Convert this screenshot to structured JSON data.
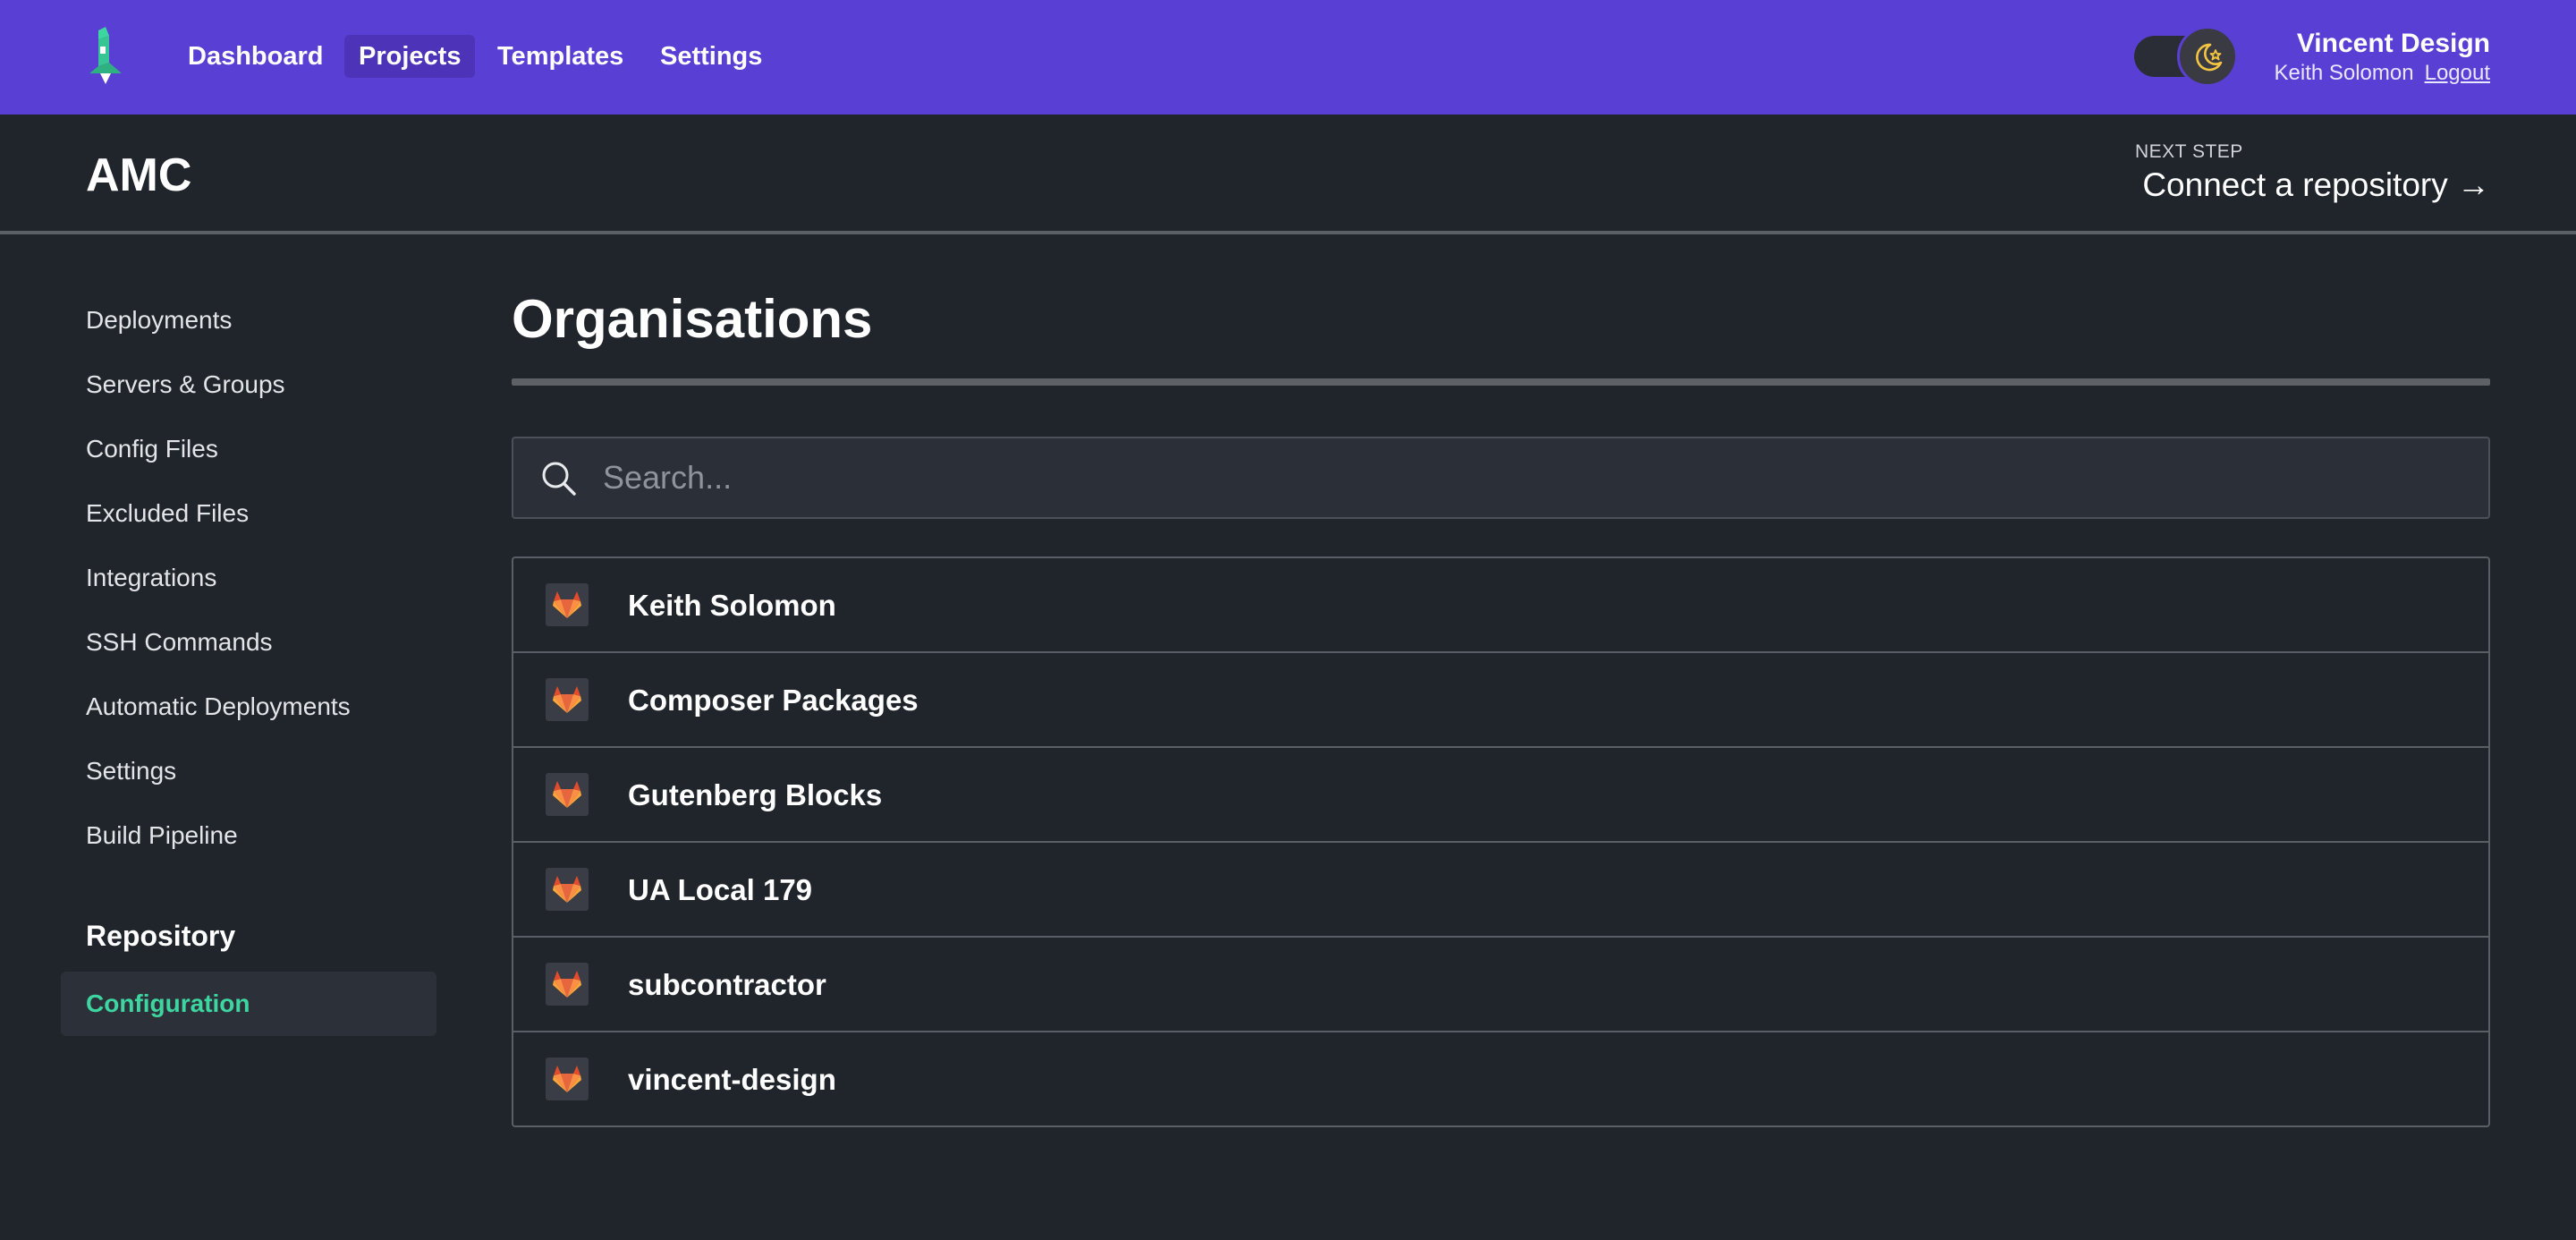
{
  "nav": {
    "items": [
      {
        "label": "Dashboard",
        "active": false
      },
      {
        "label": "Projects",
        "active": true
      },
      {
        "label": "Templates",
        "active": false
      },
      {
        "label": "Settings",
        "active": false
      }
    ],
    "theme_toggle": {
      "mode": "dark",
      "icon": "moon-star-icon"
    },
    "account": {
      "org_name": "Vincent Design",
      "user_name": "Keith Solomon",
      "logout_label": "Logout"
    }
  },
  "project": {
    "title": "AMC",
    "next_step_label": "NEXT STEP",
    "next_step_link": "Connect a repository →"
  },
  "sidebar": {
    "items": [
      {
        "label": "Deployments"
      },
      {
        "label": "Servers & Groups"
      },
      {
        "label": "Config Files"
      },
      {
        "label": "Excluded Files"
      },
      {
        "label": "Integrations"
      },
      {
        "label": "SSH Commands"
      },
      {
        "label": "Automatic Deployments"
      },
      {
        "label": "Settings"
      },
      {
        "label": "Build Pipeline"
      }
    ],
    "section_heading": "Repository",
    "active_item": "Configuration"
  },
  "main": {
    "title": "Organisations",
    "search": {
      "placeholder": "Search...",
      "value": ""
    },
    "organisations": [
      {
        "name": "Keith Solomon",
        "icon": "gitlab-icon"
      },
      {
        "name": "Composer Packages",
        "icon": "gitlab-icon"
      },
      {
        "name": "Gutenberg Blocks",
        "icon": "gitlab-icon"
      },
      {
        "name": "UA Local 179",
        "icon": "gitlab-icon"
      },
      {
        "name": "subcontractor",
        "icon": "gitlab-icon"
      },
      {
        "name": "vincent-design",
        "icon": "gitlab-icon"
      }
    ]
  },
  "colors": {
    "topbar": "#5a3fd4",
    "background": "#20242b",
    "accent_green": "#3ed6a0",
    "gitlab_orange": "#e8663d"
  }
}
